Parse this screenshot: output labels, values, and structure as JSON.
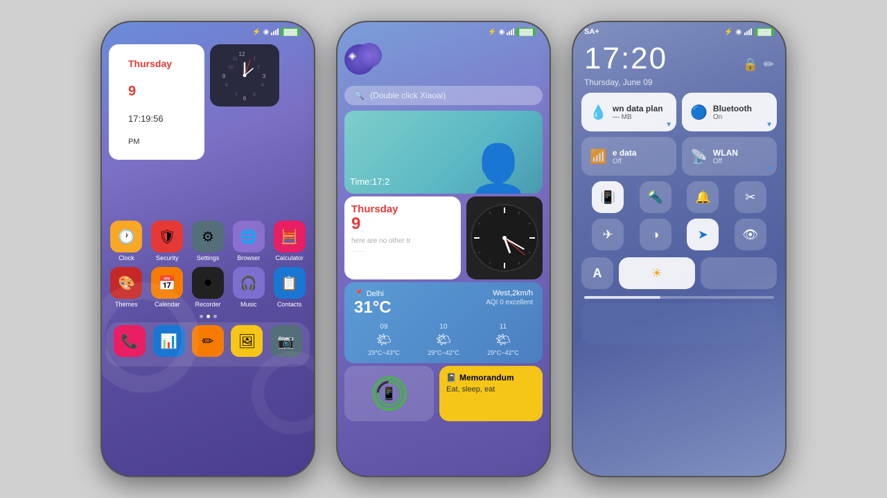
{
  "phone1": {
    "status": {
      "bluetooth": "⚡",
      "signal": "▊▊▊",
      "battery": "▓▓▓"
    },
    "date_widget": {
      "day_name": "Thursday",
      "day_num": "9",
      "time": "17:19:56",
      "ampm": "PM"
    },
    "apps_row1": [
      {
        "label": "Clock",
        "icon": "🕐",
        "bg": "#f9a825"
      },
      {
        "label": "Security",
        "icon": "🛡",
        "bg": "#e53935"
      },
      {
        "label": "Settings",
        "icon": "⚙",
        "bg": "#546e7a"
      },
      {
        "label": "Browser",
        "icon": "🌐",
        "bg": "#8b6fcf"
      },
      {
        "label": "Calculator",
        "icon": "🧮",
        "bg": "#e91e63"
      }
    ],
    "apps_row2": [
      {
        "label": "Themes",
        "icon": "🎨",
        "bg": "#c62828"
      },
      {
        "label": "Calendar",
        "icon": "📅",
        "bg": "#f57c00"
      },
      {
        "label": "Recorder",
        "icon": "⏺",
        "bg": "#212121"
      },
      {
        "label": "Music",
        "icon": "🎧",
        "bg": "#7b6fcf"
      },
      {
        "label": "Contacts",
        "icon": "📋",
        "bg": "#1976d2"
      }
    ],
    "apps_row3": [
      {
        "label": "",
        "icon": "📞",
        "bg": "#e91e63"
      },
      {
        "label": "",
        "icon": "📊",
        "bg": "#1976d2"
      },
      {
        "label": "",
        "icon": "✏",
        "bg": "#f57c00"
      },
      {
        "label": "",
        "icon": "🖼",
        "bg": "#f5c518"
      },
      {
        "label": "",
        "icon": "📷",
        "bg": "#546e7a"
      }
    ]
  },
  "phone2": {
    "status": {
      "bluetooth": "⚡",
      "signal": "▊▊▊",
      "battery": "▓▓▓"
    },
    "search_placeholder": "(Double click Xiaoai)",
    "anime_time": "Time:17:2",
    "calendar": {
      "day_name": "Thursday",
      "day_num": "9",
      "note": "here are no other tr",
      "dots": "......."
    },
    "weather": {
      "location": "Delhi",
      "temp": "31°C",
      "wind": "West,2km/h",
      "aqi": "AQI  0  excellent",
      "forecast": [
        {
          "day": "09",
          "temp": "29°C~43°C",
          "icon": "🌤"
        },
        {
          "day": "10",
          "temp": "29°C~42°C",
          "icon": "🌤"
        },
        {
          "day": "11",
          "temp": "29°C~42°C",
          "icon": "🌤"
        }
      ]
    },
    "memo": {
      "title": "Memorandum",
      "text": "Eat, sleep, eat"
    }
  },
  "phone3": {
    "status": {
      "sa": "SA+",
      "bluetooth": "⚡",
      "signal": "▊▊▊",
      "battery": "▓▓▓"
    },
    "time": "17:20",
    "date": "Thursday, June 09",
    "tiles": [
      {
        "label": "wn data plan",
        "sub": "— MB",
        "icon": "💧",
        "active": true,
        "corner": true
      },
      {
        "label": "Bluetooth",
        "sub": "On",
        "icon": "🔵",
        "active": true,
        "corner": true
      },
      {
        "label": "e data",
        "sub": "Off",
        "icon": "📶",
        "active": false,
        "corner": false
      },
      {
        "label": "WLAN",
        "sub": "Off",
        "icon": "📡",
        "active": false,
        "corner": true
      }
    ],
    "icon_row1": [
      {
        "icon": "📳",
        "label": "vibrate",
        "active": true
      },
      {
        "icon": "🔦",
        "label": "flashlight",
        "active": false
      },
      {
        "icon": "🔔",
        "label": "notification",
        "active": false
      },
      {
        "icon": "✂",
        "label": "screenshot",
        "active": false
      }
    ],
    "icon_row2": [
      {
        "icon": "✈",
        "label": "airplane",
        "active": false
      },
      {
        "icon": "◑",
        "label": "auto-brightness",
        "active": false
      },
      {
        "icon": "➤",
        "label": "location",
        "active": true
      },
      {
        "icon": "👁",
        "label": "eye-comfort",
        "active": false
      }
    ],
    "bottom": {
      "a_label": "A",
      "brightness_icon": "☀"
    },
    "volume_pct": 40
  }
}
